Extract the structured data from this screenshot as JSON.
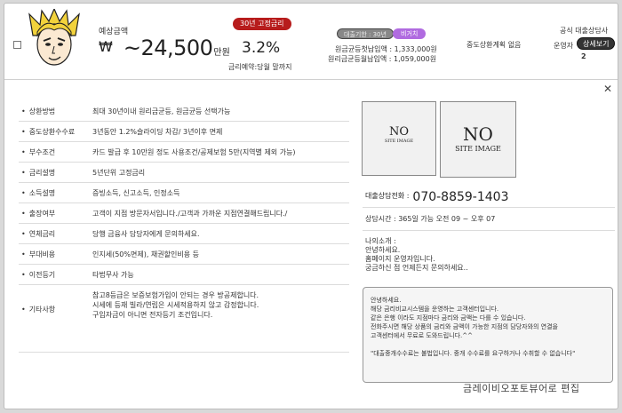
{
  "header": {
    "monthly_payment_label": "예상금액",
    "currency_symbol": "₩",
    "amount": "~24,500",
    "amount_unit": "만원",
    "rate_badge": "30년 고정금리",
    "rate": "3.2%",
    "rate_note": "금리예약:당월 말까지",
    "term_badge": "대출기한 : 30년",
    "purple_badge": "비거치",
    "first_payment": "원금균등첫납입액 : 1,333,000원",
    "first_payment_equal": "원리금균등월납입액 : 1,059,000원",
    "early_repay_plan": "중도상환계획 없음",
    "official_consultant": "공식 대출상담사",
    "operators_label": "운영자",
    "operators_count": "2",
    "detail_button": "상세보기"
  },
  "details": [
    {
      "key": "상환방법",
      "value": "최대 30년이내 원리금균등, 원금균등 선택가능"
    },
    {
      "key": "중도상환수수료",
      "value": "3년동안 1.2%슬라이딩 차감/ 3년이후 면제"
    },
    {
      "key": "부수조건",
      "value": "카드 발급 후 10만원 정도 사용조건/공제보험 5만(지역별 제외 가능)"
    },
    {
      "key": "금리설명",
      "value": "5년단위 고정금리"
    },
    {
      "key": "소득설명",
      "value": "증빙소득, 신고소득, 인정소득"
    },
    {
      "key": "출장여부",
      "value": "고객이 지점 방문자서입니다./고객과 가까운 지점연결해드립니다./"
    },
    {
      "key": "연체금리",
      "value": "당행 금융사 담당자에게 문의하세요."
    },
    {
      "key": "부대비용",
      "value": "인지세(50%면제), 채권할인비용 등"
    },
    {
      "key": "이전등기",
      "value": "타법무사 가능"
    },
    {
      "key": "기타사항",
      "value_lines": [
        "참고8등급은 보증보험가입이 안되는 경우 방공제합니다.",
        "시세에 등재 빌라/연립은 시세적용하지 않고 감정합니다.",
        "구입자금이 아니면 전자등기 조건입니다."
      ]
    }
  ],
  "images": {
    "a_big": "NO",
    "a_small": "SITE IMAGE",
    "b_big": "NO",
    "b_small": "SITE IMAGE"
  },
  "contact": {
    "phone_label": "대출상담전화 :",
    "phone": "070-8859-1403",
    "hours": "상담시간 : 365일 가능 오전 09 ~ 오후 07"
  },
  "intro": {
    "title": "나의소개 :",
    "lines": [
      "안녕하세요.",
      "홈페이지 운영자입니다.",
      "궁금하신 점 언제든지 문의하세요.."
    ]
  },
  "notice": {
    "lines": [
      "안녕하세요.",
      "해당 금리비교시스템을 운영하는 고객센터입니다.",
      "같은 은행 이라도 지점마다 금리와 금액는 다를 수 있습니다.",
      "전화주시면 해당 상품의 금리와 금액이 가능한 지점의 담당자와의 연결을",
      "고객센터에서 무료로 도와드립니다.^^"
    ],
    "warning": "\"대출중개수수료는 불법입니다. 중개 수수료를 요구하거나 수취할 수 없습니다\""
  },
  "watermark": "금레이비오포토뷰어로 편집"
}
